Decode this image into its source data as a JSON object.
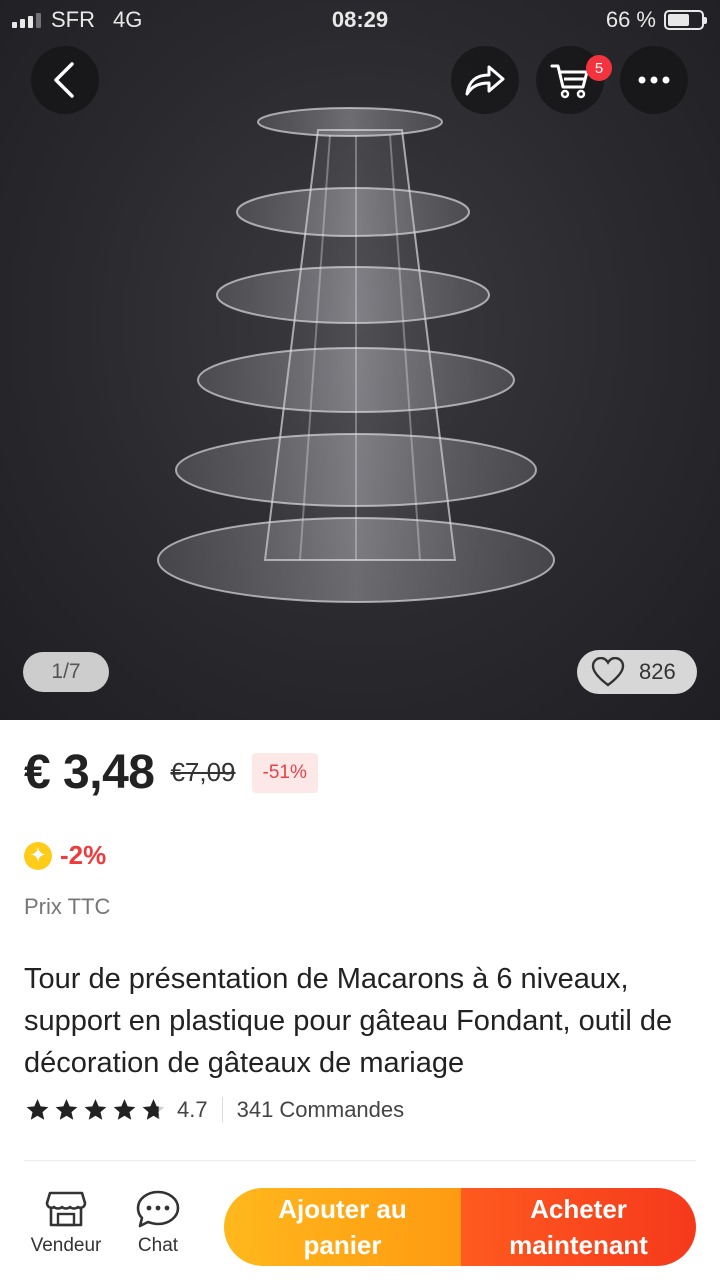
{
  "status_bar": {
    "carrier": "SFR",
    "network": "4G",
    "time": "08:29",
    "battery": "66 %",
    "battery_level": 0.66
  },
  "header": {
    "back_icon": "chevron-left-icon",
    "share_icon": "share-arrow-icon",
    "cart_icon": "cart-icon",
    "cart_badge": "5",
    "more_icon": "more-dots-icon"
  },
  "gallery": {
    "counter": "1/7",
    "likes": "826",
    "like_icon": "heart-outline-icon"
  },
  "product": {
    "price": "€ 3,48",
    "old_price": "€7,09",
    "discount": "-51%",
    "coin_discount": "-2%",
    "coin_icon": "coin-icon",
    "tax_label": "Prix TTC",
    "title": "Tour de présentation de Macarons à 6 niveaux, support en plastique pour gâteau Fondant, outil de décoration de gâteaux de mariage",
    "rating": "4.7",
    "rating_stars": 4.7,
    "orders": "341 Commandes"
  },
  "bottom_bar": {
    "vendeur_label": "Vendeur",
    "chat_label": "Chat",
    "add_to_cart_label": "Ajouter au panier",
    "buy_now_label": "Acheter maintenant"
  },
  "colors": {
    "accent_red": "#f5391c",
    "accent_orange": "#ffb81c",
    "star": "#222222",
    "badge": "#f5333f"
  }
}
